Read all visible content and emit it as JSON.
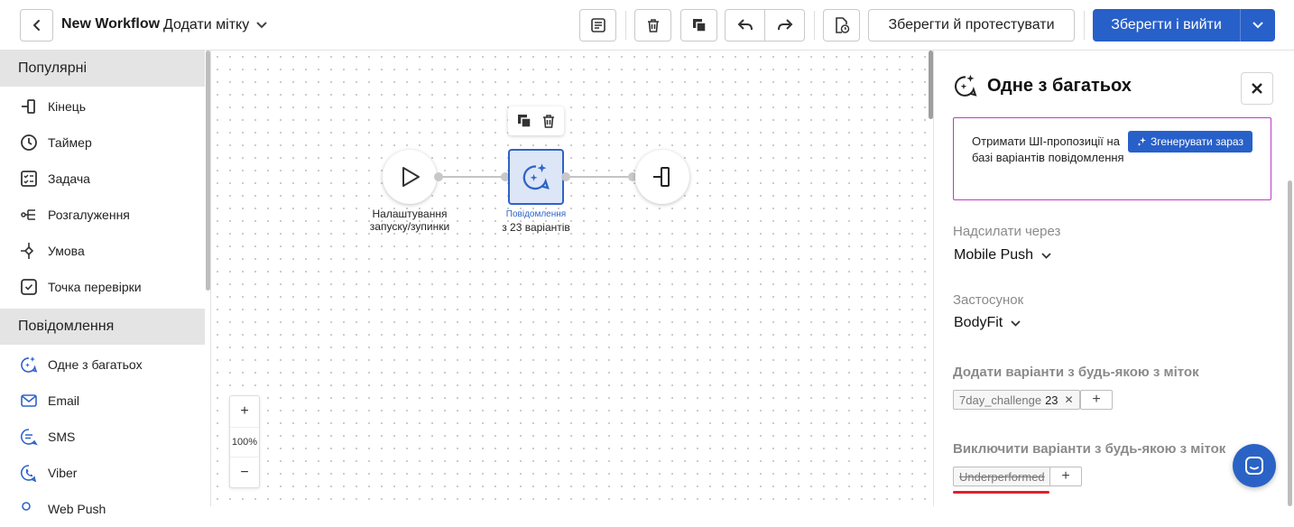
{
  "header": {
    "workflow_title": "New Workflow",
    "add_tag_label": "Додати мітку",
    "save_test_label": "Зберегти й протестувати",
    "save_exit_label": "Зберегти і вийти"
  },
  "sidebar": {
    "sections": [
      {
        "title": "Популярні",
        "items": [
          {
            "label": "Кінець",
            "icon": "end-icon"
          },
          {
            "label": "Таймер",
            "icon": "timer-icon"
          },
          {
            "label": "Задача",
            "icon": "task-icon"
          },
          {
            "label": "Розгалуження",
            "icon": "branch-icon"
          },
          {
            "label": "Умова",
            "icon": "condition-icon"
          },
          {
            "label": "Точка перевірки",
            "icon": "checkpoint-icon"
          }
        ]
      },
      {
        "title": "Повідомлення",
        "items": [
          {
            "label": "Одне з багатьох",
            "icon": "ai-message-icon"
          },
          {
            "label": "Email",
            "icon": "email-icon"
          },
          {
            "label": "SMS",
            "icon": "sms-icon"
          },
          {
            "label": "Viber",
            "icon": "viber-icon"
          },
          {
            "label": "Web Push",
            "icon": "web-push-icon"
          }
        ]
      }
    ]
  },
  "canvas": {
    "start_node_label_1": "Налаштування",
    "start_node_label_2": "запуску/зупинки",
    "message_node_label_1": "Повідомлення",
    "message_node_label_2": "з 23 варіантів",
    "zoom_in": "+",
    "zoom_level": "100%",
    "zoom_out": "−"
  },
  "panel": {
    "title": "Одне з багатьох",
    "ai_prompt_text": "Отримати ШІ-пропозиції на базі варіантів повідомлення",
    "ai_button_label": "Згенерувати зараз",
    "send_via_label": "Надсилати через",
    "send_via_value": "Mobile Push",
    "app_label": "Застосунок",
    "app_value": "BodyFit",
    "include_label": "Додати варіанти з будь-якою з міток",
    "include_tag_name": "7day_challenge",
    "include_tag_count": "23",
    "exclude_label": "Виключити варіанти з будь-якою з міток",
    "exclude_tag_name": "Underperformed",
    "add_symbol": "+"
  },
  "colors": {
    "primary": "#2860c9",
    "ai_box_border": "#c03ac8",
    "highlight_underline": "#e0202a",
    "selected_node_fill": "#dce6f7"
  }
}
